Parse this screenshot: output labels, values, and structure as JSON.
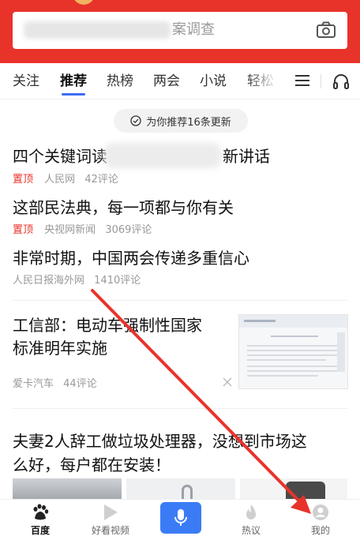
{
  "search": {
    "placeholder_visible": "案调查"
  },
  "tabs": [
    {
      "label": "关注"
    },
    {
      "label": "推荐"
    },
    {
      "label": "热榜"
    },
    {
      "label": "两会"
    },
    {
      "label": "小说"
    },
    {
      "label": "轻松"
    }
  ],
  "feed": {
    "update_notice": "为你推荐16条更新",
    "items": [
      {
        "title_start": "四个关键词读",
        "title_end": "新讲话",
        "pin": "置顶",
        "source": "人民网",
        "comments": "42评论"
      },
      {
        "title": "这部民法典，每一项都与你有关",
        "pin": "置顶",
        "source": "央视网新闻",
        "comments": "3069评论"
      },
      {
        "title": "非常时期，中国两会传递多重信心",
        "source": "人民日报海外网",
        "comments": "1410评论"
      },
      {
        "title_line1": "工信部：电动车强制性国家",
        "title_line2": "标准明年实施",
        "source": "爱卡汽车",
        "comments": "44评论"
      },
      {
        "title_line1": "夫妻2人辞工做垃圾处理器，没想到市场这",
        "title_line2": "么好，每户都在安装！"
      }
    ]
  },
  "bottom_nav": {
    "items": [
      {
        "label": "百度",
        "icon": "baidu-paw-icon"
      },
      {
        "label": "好看视频",
        "icon": "play-icon"
      },
      {
        "label": "",
        "icon": "microphone-icon"
      },
      {
        "label": "热议",
        "icon": "flame-icon"
      },
      {
        "label": "我的",
        "icon": "user-icon"
      }
    ]
  },
  "colors": {
    "brand_red": "#e8332b",
    "accent_blue": "#3b6cf6",
    "annotation_arrow": "#e8332b"
  }
}
